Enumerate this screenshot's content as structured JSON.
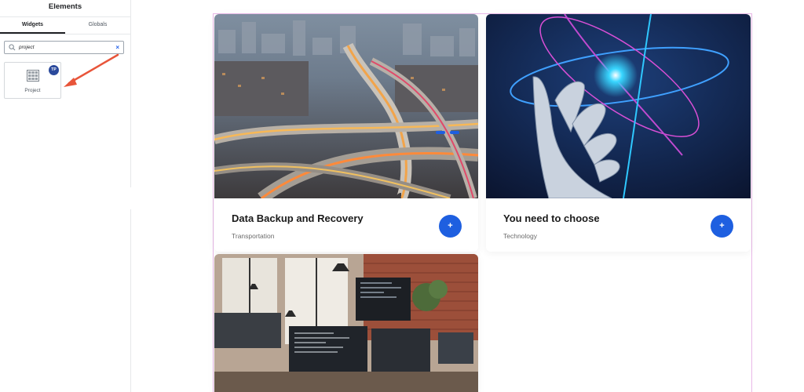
{
  "sidebar": {
    "title": "Elements",
    "tabs": [
      {
        "label": "Widgets",
        "active": true
      },
      {
        "label": "Globals",
        "active": false
      }
    ],
    "search": {
      "value": "project",
      "clear_symbol": "×"
    },
    "widget": {
      "label": "Project",
      "badge": "TP"
    },
    "collapse_symbol": "‹"
  },
  "colors": {
    "accent_blue": "#1e5fe0",
    "badge_navy": "#2b4a9c",
    "arrow_orange": "#e8553a",
    "section_outline": "#e9b8e8"
  },
  "projects": [
    {
      "title": "Data Backup and Recovery",
      "category": "Transportation",
      "plus": "+",
      "image": "highway-interchange-night-photo"
    },
    {
      "title": "You need to choose",
      "category": "Technology",
      "plus": "+",
      "image": "robot-hand-atom-photo"
    },
    {
      "title": "",
      "category": "",
      "image": "office-computer-monitors-photo"
    }
  ]
}
